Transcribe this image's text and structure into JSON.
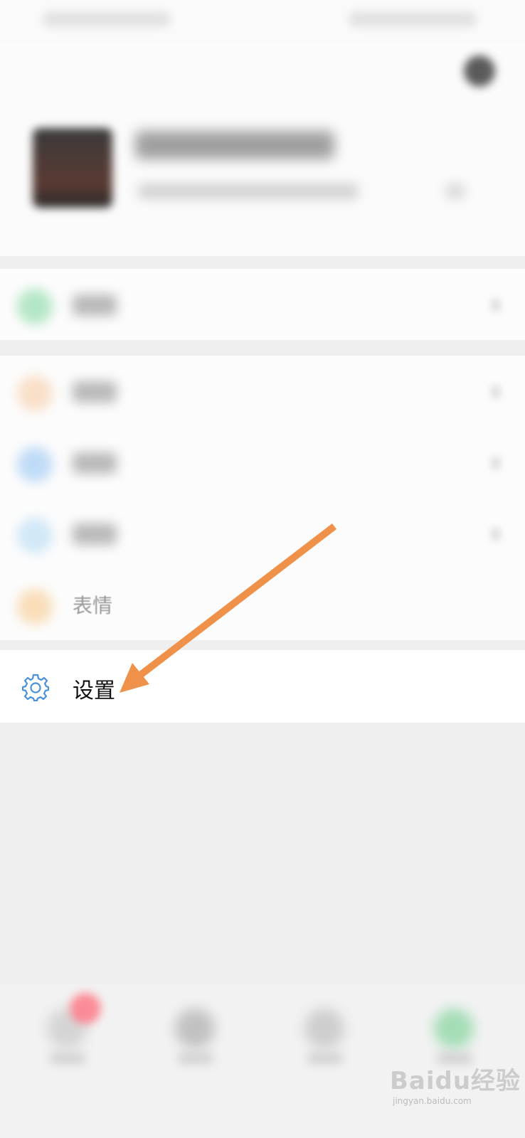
{
  "menu": {
    "emoji_label": "表情",
    "settings_label": "设置"
  },
  "watermark": {
    "text": "Baidu经验",
    "sub": "jingyan.baidu.com"
  },
  "colors": {
    "settings_icon": "#4a90d9",
    "arrow": "#f0914a"
  },
  "icons": {
    "settings": "gear-icon"
  }
}
